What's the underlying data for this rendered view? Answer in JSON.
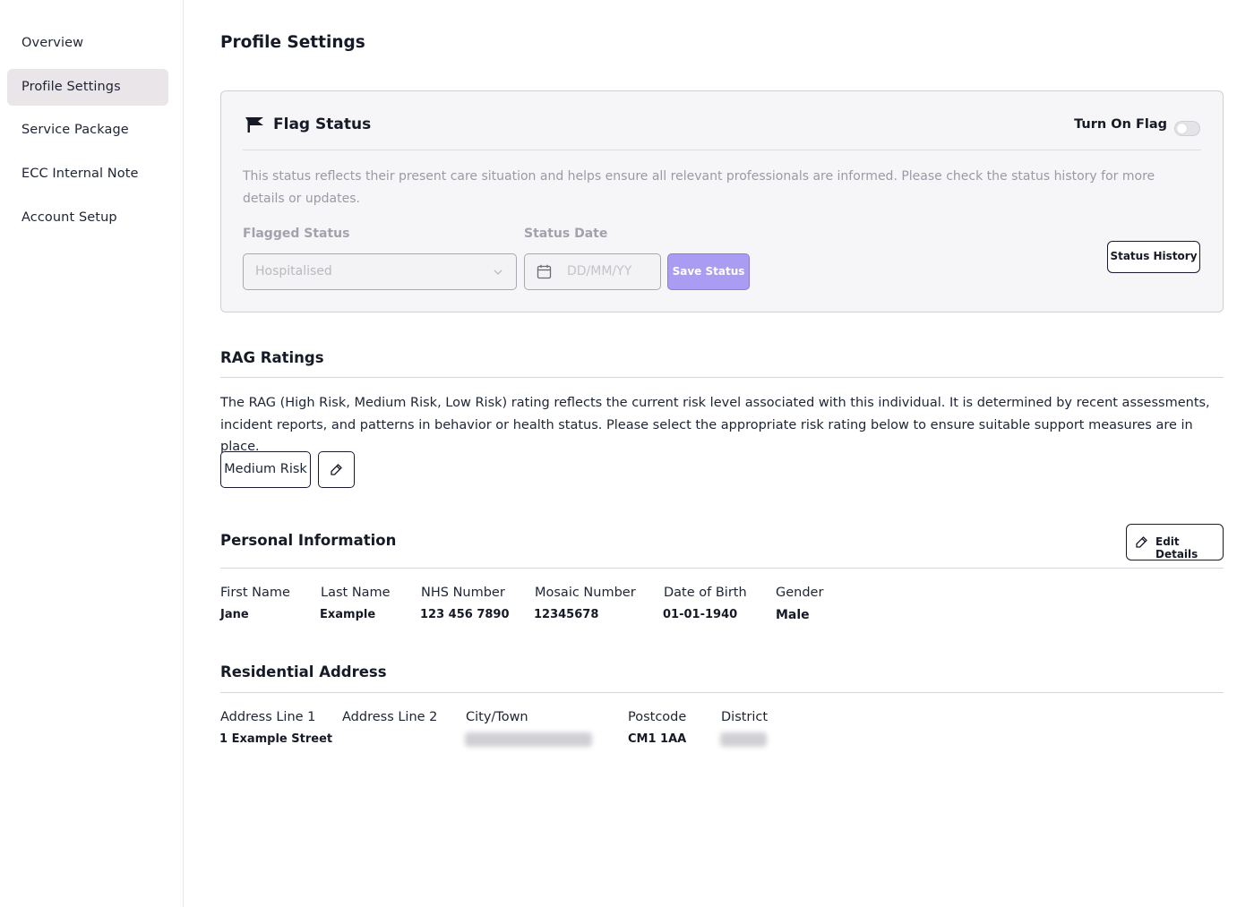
{
  "sidebar": {
    "items": [
      {
        "label": "Overview"
      },
      {
        "label": "Profile Settings"
      },
      {
        "label": "Service Package"
      },
      {
        "label": "ECC Internal Note"
      },
      {
        "label": "Account Setup"
      }
    ],
    "active": "Profile Settings"
  },
  "page": {
    "title": "Profile Settings"
  },
  "flag_status": {
    "title": "Flag Status",
    "toggle_label": "Turn On Flag",
    "toggle_on": false,
    "description": "This status reflects their present care situation and helps ensure all relevant professionals are informed. Please check the status history for more details or updates.",
    "flagged_status_label": "Flagged Status",
    "flagged_status_value": "Hospitalised",
    "status_date_label": "Status Date",
    "status_date_placeholder": "DD/MM/YY",
    "save_button": "Save Status",
    "history_button": "Status History"
  },
  "rag": {
    "title": "RAG Ratings",
    "description": "The RAG (High Risk, Medium Risk, Low Risk) rating reflects the current risk level associated with this individual. It is determined by recent assessments, incident reports, and patterns in behavior or health status. Please select the appropriate risk rating below to ensure suitable support measures are in place.",
    "current_rating": "Medium Risk"
  },
  "personal_info": {
    "title": "Personal Information",
    "edit_button": "Edit Details",
    "fields": [
      {
        "label": "First Name",
        "value": "Jane"
      },
      {
        "label": "Last Name",
        "value": "Example"
      },
      {
        "label": "NHS Number",
        "value": "123 456 7890"
      },
      {
        "label": "Mosaic Number",
        "value": "12345678"
      },
      {
        "label": "Date of Birth",
        "value": "01-01-1940"
      },
      {
        "label": "Gender",
        "value": "Male"
      }
    ]
  },
  "address": {
    "title": "Residential Address",
    "fields": [
      {
        "label": "Address Line 1",
        "value": "1 Example Street"
      },
      {
        "label": "Address Line 2",
        "value": ""
      },
      {
        "label": "City/Town",
        "value": ""
      },
      {
        "label": "Postcode",
        "value": "CM1 1AA"
      },
      {
        "label": "District",
        "value": ""
      }
    ]
  },
  "colors": {
    "accent": "#a99cf2",
    "active_nav_bg": "#eae5e8",
    "card_bg": "#f6f6f8"
  },
  "icons": [
    "flag-icon",
    "chevron-down-icon",
    "calendar-icon",
    "pencil-icon"
  ]
}
